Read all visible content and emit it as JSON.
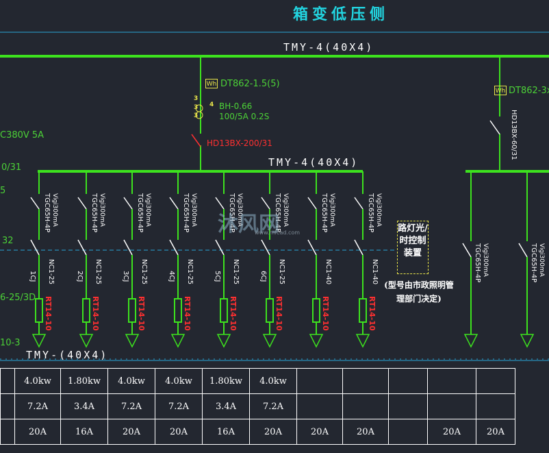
{
  "title": "箱变低压侧",
  "main_bus": "TMY-4(40X4)",
  "mid_bus": "TMY-4(40X4)",
  "low_bus": "TMY-(40X4)",
  "meter_left": "DT862-1.5(5)",
  "meter_right": "DT862-3x",
  "wh_label": "Wh",
  "ct_model": "BH-0.66",
  "ct_ratio": "100/5A 0.2S",
  "ct_marks": [
    "3",
    "4",
    "3",
    "3"
  ],
  "main_switch": "HD13BX-200/31",
  "right_switch": "HD13BX-60/31",
  "left_edge": {
    "supply": "C380V 5A",
    "l1": "0/31",
    "l2": "5",
    "l3": "32",
    "l4": "6-25/3D",
    "l5": "10-3"
  },
  "branches": [
    {
      "breaker": "TGC65H-4P",
      "setting": "Vigi300mA",
      "contactor": "1CJ",
      "relay": "NC1-25",
      "fuse": "RT14-10"
    },
    {
      "breaker": "TGC65H-4P",
      "setting": "Vigi300mA",
      "contactor": "2CJ",
      "relay": "NC1-25",
      "fuse": "RT14-10"
    },
    {
      "breaker": "TGC65H-4P",
      "setting": "Vigi300mA",
      "contactor": "3CJ",
      "relay": "NC1-25",
      "fuse": "RT14-10"
    },
    {
      "breaker": "TGC65H-4P",
      "setting": "Vigi300mA",
      "contactor": "4CJ",
      "relay": "NC1-25",
      "fuse": "RT14-10"
    },
    {
      "breaker": "TGC65H-4P",
      "setting": "Vigi300mA",
      "contactor": "5CJ",
      "relay": "NC1-25",
      "fuse": "RT14-10"
    },
    {
      "breaker": "TGC65H-4P",
      "setting": "Vigi300mA",
      "contactor": "6CJ",
      "relay": "NC1-25",
      "fuse": "RT14-10"
    },
    {
      "breaker": "TGC65H-4P",
      "setting": "Vigi300mA",
      "contactor": "",
      "relay": "NC1-40",
      "fuse": "RT14-10"
    },
    {
      "breaker": "TGC65H-4P",
      "setting": "Vigi300mA",
      "contactor": "",
      "relay": "NC1-40",
      "fuse": "RT14-10"
    }
  ],
  "right_branches": [
    {
      "breaker": "TGC65H-4P",
      "setting": "Vigi300mA"
    },
    {
      "breaker": "TGC65H-4P",
      "setting": "Vigi300mA"
    }
  ],
  "control_box": "路灯光/时控制装置",
  "control_note": "(型号由市政照明管理部门决定)",
  "watermark": "沐风网",
  "watermark_url": "www.mfcad.com",
  "table": {
    "row_power": [
      "",
      "4.0kw",
      "1.80kw",
      "4.0kw",
      "4.0kw",
      "1.80kw",
      "4.0kw",
      "",
      "",
      "",
      "",
      ""
    ],
    "row_current": [
      "",
      "7.2A",
      "3.4A",
      "7.2A",
      "7.2A",
      "3.4A",
      "7.2A",
      "",
      "",
      "",
      "",
      ""
    ],
    "row_rating": [
      "",
      "20A",
      "16A",
      "20A",
      "20A",
      "16A",
      "20A",
      "20A",
      "20A",
      "",
      "20A",
      "20A"
    ]
  },
  "colors": {
    "background": "#232730",
    "bus": "#3de21e",
    "text_green": "#4cd237",
    "title": "#22d4e0",
    "red": "#ff3030",
    "accent": "#e8e44a",
    "dash": "#2aa6d6"
  }
}
